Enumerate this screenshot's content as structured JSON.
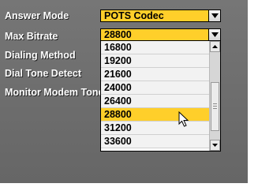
{
  "form": {
    "labels": {
      "answer_mode": "Answer Mode",
      "max_bitrate": "Max Bitrate",
      "dialing_method": "Dialing Method",
      "dial_tone_detect": "Dial Tone Detect",
      "monitor_modem_tone": "Monitor Modem Tone"
    },
    "answer_mode_value": "POTS Codec",
    "max_bitrate_value": "28800"
  },
  "bitrate_options": [
    "16800",
    "19200",
    "21600",
    "24000",
    "26400",
    "28800",
    "31200",
    "33600"
  ],
  "selected_index": 5,
  "icons": {
    "dropdown": "chevron-down-icon",
    "cursor": "mouse-pointer-icon"
  },
  "colors": {
    "panel": "#6d6d6d",
    "highlight": "#ffcf2a",
    "label_text": "#ffffff"
  }
}
